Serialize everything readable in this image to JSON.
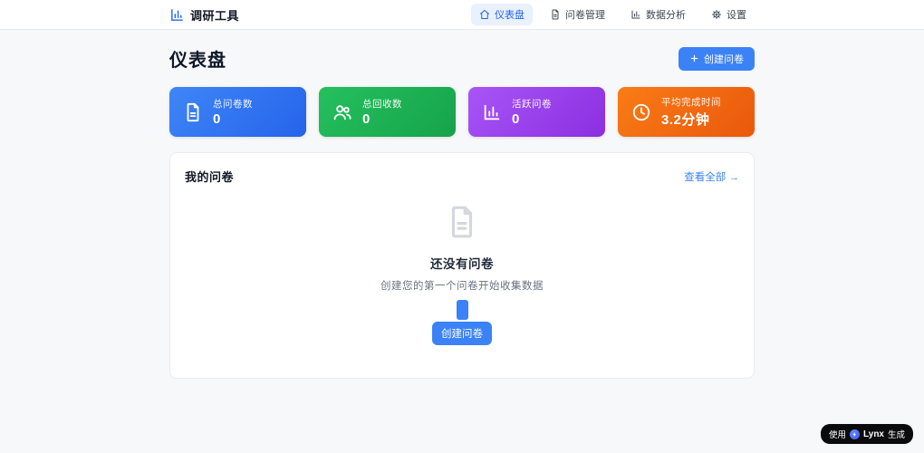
{
  "header": {
    "logo_text": "调研工具",
    "nav": [
      {
        "label": "仪表盘",
        "icon": "home-icon",
        "active": true
      },
      {
        "label": "问卷管理",
        "icon": "document-icon",
        "active": false
      },
      {
        "label": "数据分析",
        "icon": "bar-chart-icon",
        "active": false
      },
      {
        "label": "设置",
        "icon": "gear-icon",
        "active": false
      }
    ]
  },
  "page": {
    "title": "仪表盘",
    "create_button_label": "创建问卷"
  },
  "stats": [
    {
      "label": "总问卷数",
      "value": "0",
      "icon": "document-icon",
      "color_from": "#3f86f7",
      "color_to": "#2563eb"
    },
    {
      "label": "总回收数",
      "value": "0",
      "icon": "users-icon",
      "color_from": "#25c05e",
      "color_to": "#16a34a"
    },
    {
      "label": "活跃问卷",
      "value": "0",
      "icon": "bar-chart-icon",
      "color_from": "#a855f7",
      "color_to": "#8b2fe0"
    },
    {
      "label": "平均完成时间",
      "value": "3.2分钟",
      "icon": "clock-icon",
      "color_from": "#f97c16",
      "color_to": "#ea580c"
    }
  ],
  "panel": {
    "title": "我的问卷",
    "view_all_label": "查看全部 →",
    "empty": {
      "title": "还没有问卷",
      "subtitle": "创建您的第一个问卷开始收集数据",
      "button_label": "创建问卷"
    }
  },
  "footer_badge": {
    "prefix": "使用",
    "brand": "Lynx",
    "suffix": "生成"
  },
  "colors": {
    "accent": "#3b82f6",
    "nav_active_bg": "#e9f1fd",
    "page_bg": "#f7f8fa",
    "badge_bg": "#0b0b0d"
  }
}
